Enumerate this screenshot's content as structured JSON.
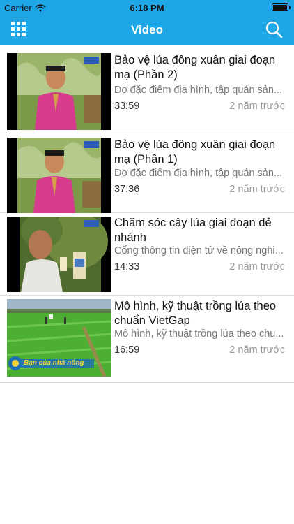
{
  "status_bar": {
    "carrier": "Carrier",
    "time": "6:18 PM"
  },
  "nav": {
    "title": "Video",
    "menu_icon": "grid-icon",
    "search_icon": "search-icon"
  },
  "colors": {
    "accent": "#1fa6e6"
  },
  "videos": [
    {
      "title": "Bảo vệ lúa đông xuân giai đoạn mạ (Phần 2)",
      "description": "Do đặc điểm địa hình, tập quán sản...",
      "duration": "33:59",
      "date": "2 năm trước",
      "thumb_icon": "tv-presenter-thumbnail"
    },
    {
      "title": "Bảo vệ lúa đông xuân giai đoạn mạ (Phần 1)",
      "description": "Do đặc điểm địa hình, tập quán sản...",
      "duration": "37:36",
      "date": "2 năm trước",
      "thumb_icon": "tv-presenter-thumbnail"
    },
    {
      "title": "Chăm sóc cây lúa giai đoạn đẻ nhánh",
      "description": "Cổng thông tin điện tử về nông nghi...",
      "duration": "14:33",
      "date": "2 năm trước",
      "thumb_icon": "farmer-interview-thumbnail"
    },
    {
      "title": "Mô hình, kỹ thuật trồng lúa theo chuẩn VietGap",
      "description": "Mô hình, kỹ thuật trồng lúa theo chu...",
      "duration": "16:59",
      "date": "2 năm trước",
      "thumb_icon": "rice-field-thumbnail",
      "thumb_logo_text": "Bạn của nhà nông"
    }
  ]
}
